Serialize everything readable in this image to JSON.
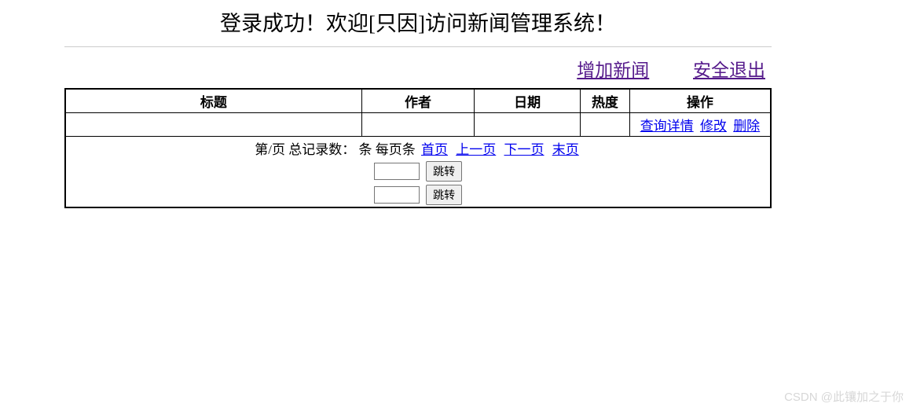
{
  "page_title": "登录成功！欢迎[只因]访问新闻管理系统！",
  "top_links": {
    "add_news": "增加新闻",
    "logout": "安全退出"
  },
  "table": {
    "headers": {
      "title": "标题",
      "author": "作者",
      "date": "日期",
      "hot": "热度",
      "op": "操作"
    },
    "rows": [
      {
        "title": "",
        "author": "",
        "date": "",
        "hot": "",
        "op_detail": "查询详情",
        "op_edit": "修改",
        "op_delete": "删除"
      }
    ]
  },
  "pager": {
    "prefix_page": "第",
    "page_sep": "/页 总记录数：",
    "suffix_records": "条 每页",
    "suffix_perpage": "条",
    "first": "首页",
    "prev": "上一页",
    "next": "下一页",
    "last": "末页",
    "jump1_value": "",
    "jump1_btn": "跳转",
    "jump2_value": "",
    "jump2_btn": "跳转"
  },
  "watermark": "CSDN @此镶加之于你"
}
